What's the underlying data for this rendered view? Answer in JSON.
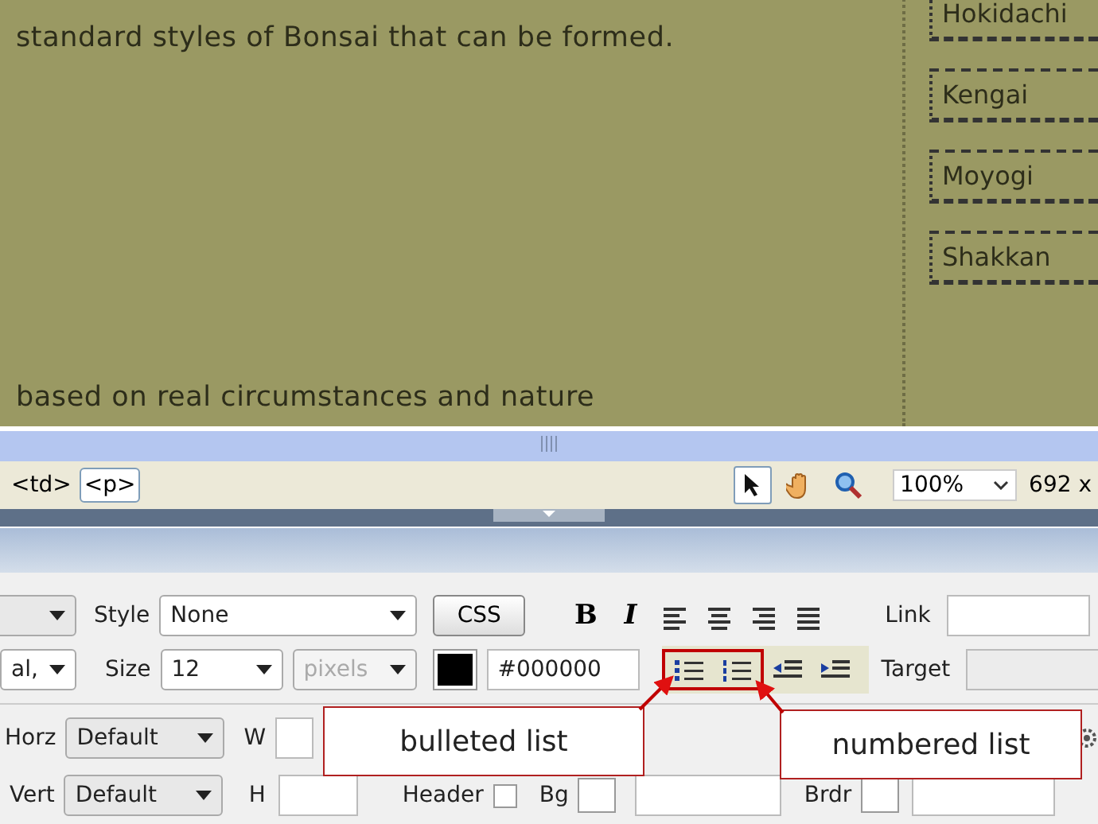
{
  "design_view": {
    "paragraphs": [
      "standard styles of Bonsai that can be formed.",
      "based on real circumstances and nature"
    ],
    "nav_items": [
      "Hokidachi",
      "Kengai",
      "Moyogi",
      "Shakkan"
    ]
  },
  "tag_selector": {
    "tags": [
      {
        "label": "<td>",
        "selected": false
      },
      {
        "label": "<p>",
        "selected": true
      }
    ],
    "tools": [
      {
        "kind": "pointer",
        "selected": true
      },
      {
        "kind": "hand",
        "selected": false
      },
      {
        "kind": "zoom",
        "selected": false
      }
    ],
    "zoom": "100%",
    "size": "692 x"
  },
  "properties": {
    "style_label": "Style",
    "style_value": "None",
    "css_button": "CSS",
    "format_buttons": [
      {
        "kind": "bold",
        "label": "B"
      },
      {
        "kind": "italic",
        "label": "I"
      },
      {
        "kind": "align-left"
      },
      {
        "kind": "align-center"
      },
      {
        "kind": "align-right"
      },
      {
        "kind": "justify"
      }
    ],
    "link_label": "Link",
    "font_value": "al,",
    "size_label": "Size",
    "size_value": "12",
    "unit_value": "pixels",
    "unit_disabled": true,
    "color_value": "#000000",
    "list_buttons": [
      {
        "kind": "unordered"
      },
      {
        "kind": "ordered"
      },
      {
        "kind": "outdent"
      },
      {
        "kind": "indent"
      }
    ],
    "target_label": "Target",
    "horz_label": "Horz",
    "horz_value": "Default",
    "w_label": "W",
    "vert_label": "Vert",
    "vert_value": "Default",
    "h_label": "H",
    "header_label": "Header",
    "header_checked": false,
    "bg_label": "Bg",
    "brdr_label": "Brdr"
  },
  "callouts": [
    {
      "text": "bulleted list"
    },
    {
      "text": "numbered list"
    }
  ]
}
